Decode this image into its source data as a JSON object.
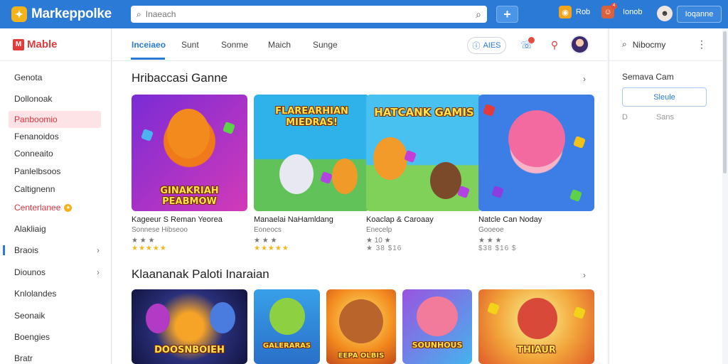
{
  "app": {
    "name": "Markeppolke",
    "logo_icon": "puzzle-icon"
  },
  "topbar": {
    "search_placeholder": "Inaeach",
    "plus_label": "+",
    "items": [
      {
        "label": "Rob",
        "icon": "coin-icon",
        "color": "#f2a51a"
      },
      {
        "label": "Ionob",
        "icon": "profile-icon",
        "color": "#d9613b",
        "badge": "4"
      },
      {
        "label": "",
        "icon": "avatar-icon"
      }
    ],
    "user_button": "Ioqanne"
  },
  "sidebar": {
    "title_mark": "M",
    "title": "Mable",
    "items": [
      {
        "label": "Genota"
      },
      {
        "label": "Dollonoak"
      },
      {
        "label": "Panboomio",
        "active": true
      },
      {
        "label": "Fenanoidos"
      },
      {
        "label": "Conneaito"
      },
      {
        "label": "Panlelbsoos"
      },
      {
        "label": "Caltignenn"
      },
      {
        "label": "Centerlanee",
        "highlight": true,
        "badge": "gold"
      },
      {
        "label": "Alakliaig"
      },
      {
        "label": "Braois",
        "chevron": true,
        "selected_bar": true
      },
      {
        "label": "Diounos",
        "chevron": true
      },
      {
        "label": "Knlolandes"
      },
      {
        "label": "Seonaik"
      },
      {
        "label": "Boengies"
      },
      {
        "label": "Bratr"
      }
    ]
  },
  "tabs": {
    "items": [
      "Inceiaeo",
      "Sunt",
      "Sonme",
      "Maich",
      "Sunge"
    ],
    "active_index": 0,
    "pill_label": "AIES",
    "icons": [
      "notification-icon",
      "location-pin-icon"
    ]
  },
  "sections": [
    {
      "title": "Hribaccasi Ganne",
      "cards": [
        {
          "title": "Kageeur S Reman Yeorea",
          "sub": "Sonnese Hibseoo",
          "meta": "★ ★ ★",
          "stars": "★★★★★",
          "art_text": "GINAKRIAH PEABMOW",
          "palette": [
            "#7a2bd6",
            "#f07a1a"
          ]
        },
        {
          "title": "Manaelai NaHamldang",
          "sub": "Eoneocs",
          "meta": "★ ★ ★",
          "stars": "★★★★★",
          "art_text": "FLAREARHIAN MIEDRAS!",
          "palette": [
            "#2fb2ea",
            "#f3d04a"
          ]
        },
        {
          "title": "Koaclap & Caroaay",
          "sub": "Enecelp",
          "meta": "★ 10 ★",
          "stars": "★ 38 $16",
          "art_text": "HATCANK GAMIS",
          "palette": [
            "#48c0f0",
            "#f29b2a"
          ]
        },
        {
          "title": "Natcle Can Noday",
          "sub": "Gooeoe",
          "meta": "★ ★ ★",
          "stars": "$38 $16 $",
          "art_text": "",
          "palette": [
            "#3d7de6",
            "#f26aa0"
          ]
        }
      ]
    },
    {
      "title": "Klaananak Paloti Inaraian",
      "cards": [
        {
          "title": "",
          "art_text": "DOOSNBOIEH",
          "palette": [
            "#2a2f7a",
            "#f5a428"
          ]
        },
        {
          "title": "",
          "art_text": "GALERARAS",
          "palette": [
            "#38a0e8",
            "#8dd143"
          ]
        },
        {
          "title": "",
          "art_text": "EEPA OLBIS",
          "palette": [
            "#f3891e",
            "#c24a1a"
          ]
        },
        {
          "title": "",
          "art_text": "SOUNHOUS",
          "palette": [
            "#9a54e0",
            "#45b3ee"
          ]
        },
        {
          "title": "",
          "art_text": "THIAUR",
          "palette": [
            "#f2a43a",
            "#e05a2a"
          ]
        }
      ]
    }
  ],
  "right_panel": {
    "title": "Nibocmy",
    "label": "Semava Cam",
    "button": "Sleule",
    "sub_left": "D",
    "sub_right": "Sans"
  }
}
